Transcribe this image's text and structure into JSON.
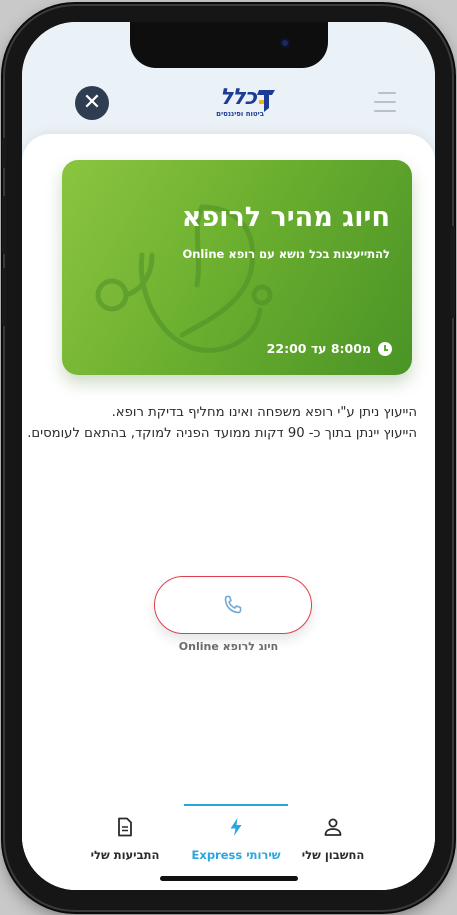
{
  "header": {
    "close_icon": "close-icon",
    "logo_text": "כלל",
    "logo_subtitle": "ביטוח ופיננסים",
    "menu_icon": "hamburger-icon"
  },
  "hero": {
    "title": "חיוג מהיר לרופא",
    "subtitle": "להתייעצות בכל נושא עם רופא Online",
    "hours": "מ8:00 עד 22:00",
    "background_colors": [
      "#8bc540",
      "#4a9426"
    ],
    "illustration": "stethoscope"
  },
  "info": {
    "line1": "הייעוץ ניתן ע\"י רופא משפחה ואינו מחליף בדיקת רופא.",
    "line2": "הייעוץ יינתן בתוך כ- 90 דקות ממועד הפניה למוקד, בהתאם לעומסים."
  },
  "call": {
    "icon": "phone-icon",
    "label": "חיוג לרופא Online",
    "border_color": "#e0404a"
  },
  "tabs": [
    {
      "label": "התביעות שלי",
      "icon": "document-icon",
      "active": false
    },
    {
      "label": "שירותי Express",
      "icon": "lightning-icon",
      "active": true
    },
    {
      "label": "החשבון שלי",
      "icon": "user-icon",
      "active": false
    }
  ],
  "colors": {
    "accent": "#2aa6df",
    "brand": "#1f3c95",
    "close_button": "#2f3d52"
  }
}
